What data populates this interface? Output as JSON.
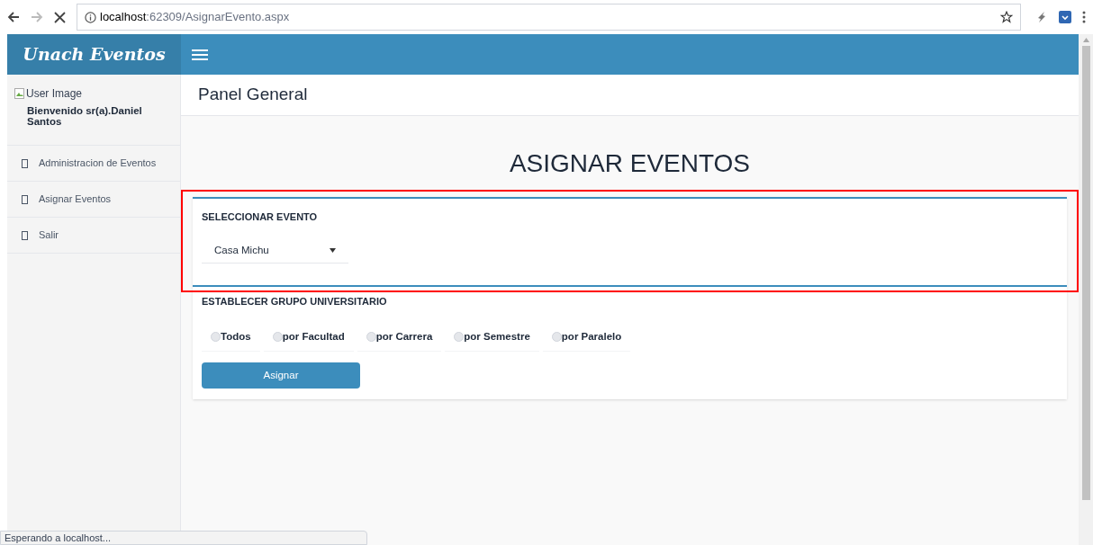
{
  "browser": {
    "url_host": "localhost",
    "url_path": ":62309/AsignarEvento.aspx"
  },
  "brand": "Unach Eventos",
  "user": {
    "image_alt": "User Image",
    "welcome": "Bienvenido sr(a).Daniel Santos"
  },
  "sidebar": {
    "items": [
      {
        "label": "Administracion de Eventos",
        "selected": false
      },
      {
        "label": "Asignar Eventos",
        "selected": false
      },
      {
        "label": "Salir",
        "selected": false
      }
    ]
  },
  "page_header": "Panel General",
  "title": "ASIGNAR EVENTOS",
  "event_section": {
    "label": "SELECCIONAR EVENTO",
    "value": "Casa Michu",
    "highlighted": true
  },
  "group_section": {
    "label": "ESTABLECER GRUPO UNIVERSITARIO",
    "options": [
      {
        "label": "Todos",
        "selected": false
      },
      {
        "label": "por Facultad",
        "selected": false
      },
      {
        "label": "por Carrera",
        "selected": false
      },
      {
        "label": "por Semestre",
        "selected": false
      },
      {
        "label": "por Paralelo",
        "selected": false
      }
    ]
  },
  "assign_button": "Asignar",
  "status_bar": "Esperando a localhost..."
}
